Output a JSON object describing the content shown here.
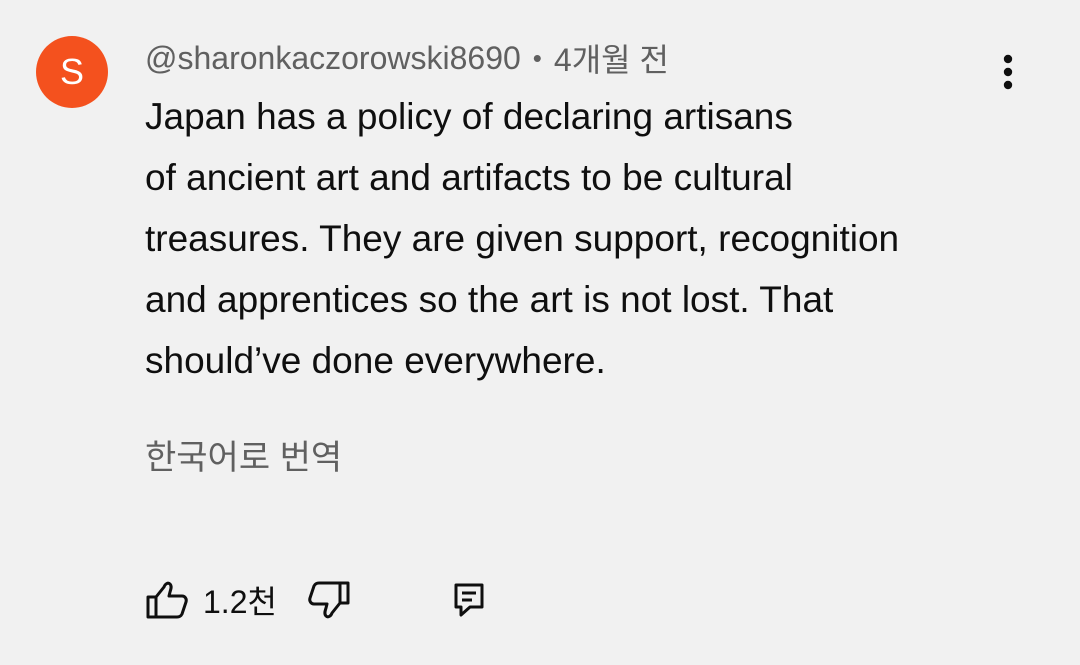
{
  "comment": {
    "avatar_letter": "S",
    "avatar_color": "#f4511e",
    "author": "@sharonkaczorowski8690",
    "separator": "•",
    "time": "4개월 전",
    "text_lines": [
      "Japan has a policy of declaring artisans",
      "of ancient art and artifacts to be cultural",
      "treasures. They are given support, recognition",
      "and apprentices so the art is not lost. That",
      "should’ve done everywhere."
    ],
    "translate_label": "한국어로 번역",
    "like_count": "1.2천"
  },
  "icons": {
    "more": "more-vert-icon",
    "like": "thumb-up-icon",
    "dislike": "thumb-down-icon",
    "reply": "reply-comment-icon"
  }
}
